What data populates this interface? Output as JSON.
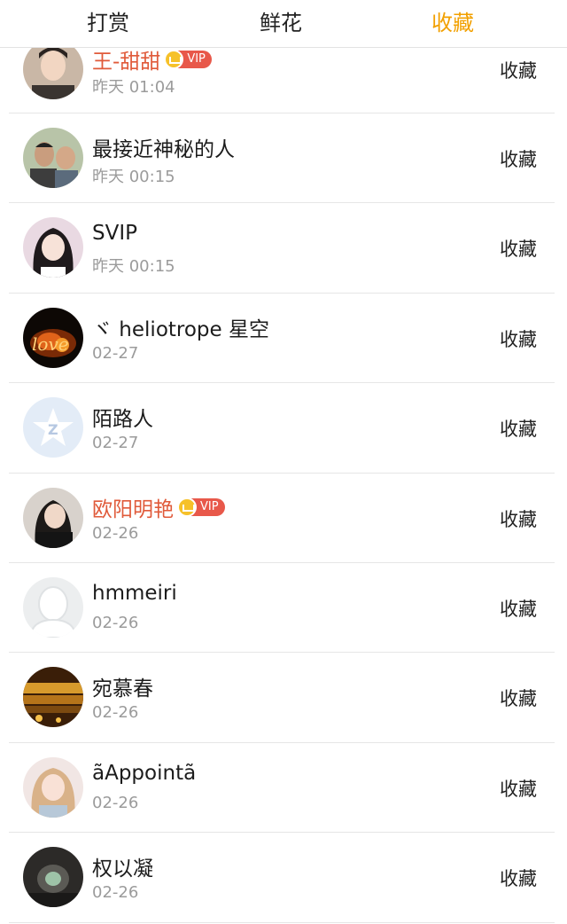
{
  "tabs": [
    {
      "label": "打赏"
    },
    {
      "label": "鲜花"
    },
    {
      "label": "收藏"
    }
  ],
  "active_tab_color": "#f2a000",
  "vip_name_color": "#e05a3a",
  "list": [
    {
      "name": "王-甜甜",
      "vip": true,
      "vip_label": "VIP",
      "time": "昨天 01:04",
      "action": "收藏",
      "avatar": "photo-man"
    },
    {
      "name": "最接近神秘的人",
      "vip": false,
      "time": "昨天 00:15",
      "action": "收藏",
      "avatar": "photo-two-men"
    },
    {
      "name": "SVIP",
      "vip": false,
      "time": "昨天 00:15",
      "action": "收藏",
      "avatar": "photo-girl"
    },
    {
      "name": "ヾ heliotrope 星空",
      "vip": false,
      "time": "02-27",
      "action": "收藏",
      "avatar": "photo-fire-love"
    },
    {
      "name": "陌路人",
      "vip": false,
      "time": "02-27",
      "action": "收藏",
      "avatar": "default-star"
    },
    {
      "name": "欧阳明艳",
      "vip": true,
      "vip_label": "VIP",
      "time": "02-26",
      "action": "收藏",
      "avatar": "photo-woman"
    },
    {
      "name": "hmmeiri",
      "vip": false,
      "time": "02-26",
      "action": "收藏",
      "avatar": "default-person"
    },
    {
      "name": "宛慕春",
      "vip": false,
      "time": "02-26",
      "action": "收藏",
      "avatar": "photo-gold"
    },
    {
      "name": "ãAppointã",
      "vip": false,
      "time": "02-26",
      "action": "收藏",
      "avatar": "photo-blonde"
    },
    {
      "name": "权以凝",
      "vip": false,
      "time": "02-26",
      "action": "收藏",
      "avatar": "photo-dark"
    }
  ]
}
